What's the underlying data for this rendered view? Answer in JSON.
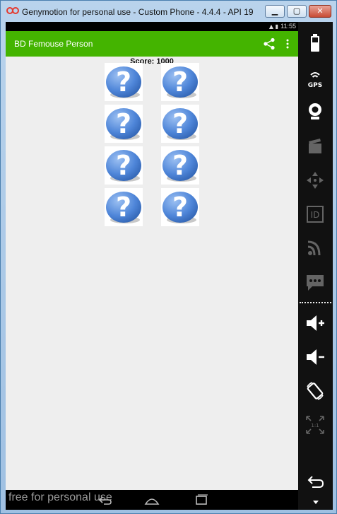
{
  "window": {
    "title": "Genymotion for personal use - Custom Phone - 4.4.4 - API 19 -...",
    "buttons": {
      "minimize": "▁",
      "maximize": "▢",
      "close": "✕"
    }
  },
  "status_bar": {
    "time": "11:55",
    "icons": "▲ ▮"
  },
  "app_bar": {
    "title": "BD Femouse Person"
  },
  "game": {
    "score": "Score: 1000",
    "cards": [
      {
        "symbol": "?"
      },
      {
        "symbol": "?"
      },
      {
        "symbol": "?"
      },
      {
        "symbol": "?"
      },
      {
        "symbol": "?"
      },
      {
        "symbol": "?"
      },
      {
        "symbol": "?"
      },
      {
        "symbol": "?"
      }
    ]
  },
  "nav_bar": {
    "watermark": "free for personal use"
  },
  "side_panel": {
    "gps_label": "GPS",
    "id_label": "ID",
    "rotate_label": "1:1",
    "icons": [
      "battery-icon",
      "gps-icon",
      "webcam-icon",
      "video-icon",
      "dpad-icon",
      "id-icon",
      "rss-icon",
      "sms-icon",
      "volume-up-icon",
      "volume-down-icon",
      "rotate-icon",
      "scale-icon",
      "back-icon"
    ]
  },
  "colors": {
    "app_bar": "#44b400",
    "content_bg": "#eeeeee",
    "card_blue": "#4f86d9"
  }
}
